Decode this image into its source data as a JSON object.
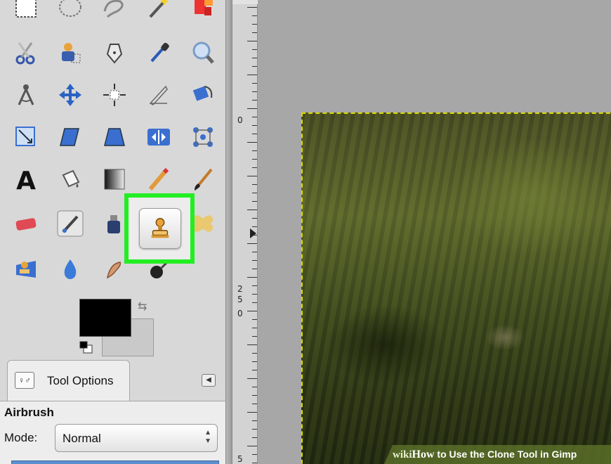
{
  "toolbox": {
    "tools": [
      {
        "name": "rect-select-tool",
        "icon": "dashed-rectangle-icon"
      },
      {
        "name": "ellipse-select-tool",
        "icon": "dashed-ellipse-icon"
      },
      {
        "name": "free-select-tool",
        "icon": "lasso-icon"
      },
      {
        "name": "fuzzy-select-tool",
        "icon": "magic-wand-icon"
      },
      {
        "name": "color-select-tool",
        "icon": "color-select-icon"
      },
      {
        "name": "scissors-select-tool",
        "icon": "scissors-icon"
      },
      {
        "name": "foreground-select-tool",
        "icon": "person-select-icon"
      },
      {
        "name": "paths-tool",
        "icon": "pen-nib-icon"
      },
      {
        "name": "color-picker-tool",
        "icon": "eyedropper-icon"
      },
      {
        "name": "zoom-tool",
        "icon": "magnifier-icon"
      },
      {
        "name": "measure-tool",
        "icon": "compass-icon"
      },
      {
        "name": "move-tool",
        "icon": "move-arrows-icon"
      },
      {
        "name": "align-tool",
        "icon": "align-icon"
      },
      {
        "name": "crop-tool",
        "icon": "crop-knife-icon"
      },
      {
        "name": "rotate-tool",
        "icon": "rotate-icon"
      },
      {
        "name": "scale-tool",
        "icon": "scale-icon"
      },
      {
        "name": "shear-tool",
        "icon": "shear-icon"
      },
      {
        "name": "perspective-tool",
        "icon": "perspective-icon"
      },
      {
        "name": "flip-tool",
        "icon": "flip-icon"
      },
      {
        "name": "cage-transform-tool",
        "icon": "cage-icon"
      },
      {
        "name": "text-tool",
        "icon": "text-a-icon"
      },
      {
        "name": "bucket-fill-tool",
        "icon": "paint-bucket-icon"
      },
      {
        "name": "blend-tool",
        "icon": "gradient-icon"
      },
      {
        "name": "pencil-tool",
        "icon": "pencil-icon"
      },
      {
        "name": "paintbrush-tool",
        "icon": "paintbrush-icon"
      },
      {
        "name": "eraser-tool",
        "icon": "eraser-icon"
      },
      {
        "name": "airbrush-tool",
        "icon": "airbrush-icon"
      },
      {
        "name": "ink-tool",
        "icon": "ink-bottle-icon"
      },
      {
        "name": "clone-tool",
        "icon": "clone-stamp-icon"
      },
      {
        "name": "heal-tool",
        "icon": "bandage-icon"
      },
      {
        "name": "perspective-clone-tool",
        "icon": "perspective-clone-icon"
      },
      {
        "name": "blur-sharpen-tool",
        "icon": "water-drop-icon"
      },
      {
        "name": "smudge-tool",
        "icon": "smudge-finger-icon"
      },
      {
        "name": "dodge-burn-tool",
        "icon": "dodge-burn-icon"
      }
    ],
    "foreground_color": "#000000",
    "background_color": "#c9c9c9",
    "highlight_color": "#22ee22"
  },
  "tool_options": {
    "tab_label": "Tool Options",
    "tool_name": "Airbrush",
    "mode_label": "Mode:",
    "mode_value": "Normal"
  },
  "ruler": {
    "labels": [
      "0",
      "2",
      "5",
      "0",
      "5"
    ]
  },
  "watermark": {
    "brand_wiki": "wiki",
    "brand_how": "How",
    "title": " to Use the Clone Tool in Gimp"
  }
}
